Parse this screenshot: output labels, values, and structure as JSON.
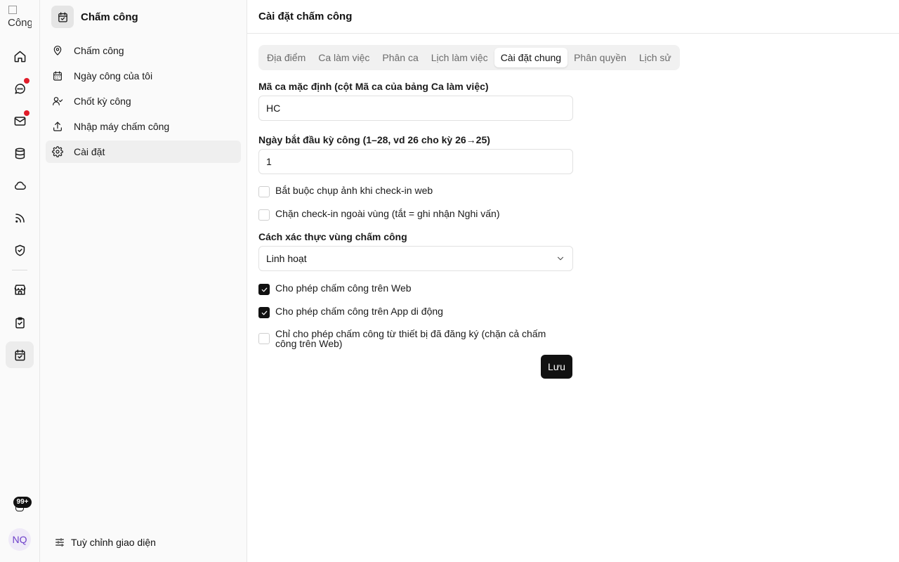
{
  "rail": {
    "logo_alt": "Công",
    "notification_badge": "99+",
    "avatar_initials": "NQ",
    "icons": [
      "home-icon",
      "chat-icon",
      "mail-icon",
      "database-icon",
      "cloud-icon",
      "rss-icon",
      "shield-check-icon",
      "store-icon",
      "clipboard-check-icon",
      "calendar-check-icon",
      "bell-icon"
    ]
  },
  "sidebar": {
    "title": "Chấm công",
    "items": [
      {
        "label": "Chấm công",
        "icon": "map-pin-icon"
      },
      {
        "label": "Ngày công của tôi",
        "icon": "calendar-icon"
      },
      {
        "label": "Chốt kỳ công",
        "icon": "user-check-icon"
      },
      {
        "label": "Nhập máy chấm công",
        "icon": "upload-icon"
      },
      {
        "label": "Cài đặt",
        "icon": "gear-icon"
      }
    ],
    "footer_label": "Tuỳ chỉnh giao diện"
  },
  "header": {
    "title": "Cài đặt chấm công"
  },
  "tabs": [
    {
      "label": "Địa điểm"
    },
    {
      "label": "Ca làm việc"
    },
    {
      "label": "Phân ca"
    },
    {
      "label": "Lịch làm việc"
    },
    {
      "label": "Cài đặt chung"
    },
    {
      "label": "Phân quyền"
    },
    {
      "label": "Lịch sử"
    }
  ],
  "form": {
    "default_shift": {
      "label": "Mã ca mặc định (cột Mã ca của bảng Ca làm việc)",
      "value": "HC"
    },
    "period_start": {
      "label": "Ngày bắt đầu kỳ công (1–28, vd 26 cho kỳ 26→25)",
      "value": "1"
    },
    "require_photo": {
      "label": "Bắt buộc chụp ảnh khi check-in web",
      "checked": false
    },
    "block_outside": {
      "label": "Chặn check-in ngoài vùng (tắt = ghi nhận Nghi vấn)",
      "checked": false
    },
    "zone_method": {
      "label": "Cách xác thực vùng chấm công",
      "value": "Linh hoạt"
    },
    "allow_web": {
      "label": "Cho phép chấm công trên Web",
      "checked": true
    },
    "allow_app": {
      "label": "Cho phép chấm công trên App di động",
      "checked": true
    },
    "registered_only": {
      "label": "Chỉ cho phép chấm công từ thiết bị đã đăng ký (chặn cả chấm công trên Web)",
      "checked": false
    },
    "save_label": "Lưu"
  },
  "colors": {
    "primary": "#111111",
    "notification_dot": "#e11d2a",
    "avatar_text": "#6d3fc9"
  }
}
